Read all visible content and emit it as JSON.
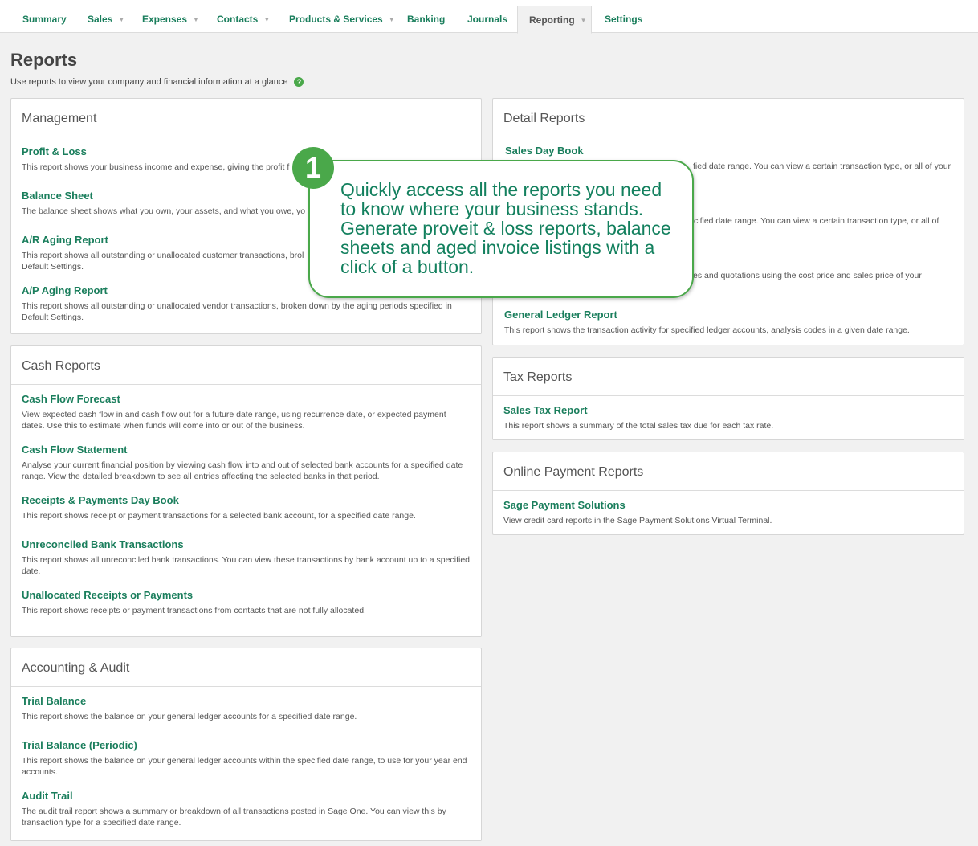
{
  "nav": {
    "tabs": [
      {
        "label": "Summary",
        "dropdown": false
      },
      {
        "label": "Sales",
        "dropdown": true
      },
      {
        "label": "Expenses",
        "dropdown": true
      },
      {
        "label": "Contacts",
        "dropdown": true
      },
      {
        "label": "Products & Services",
        "dropdown": true
      },
      {
        "label": "Banking",
        "dropdown": false
      },
      {
        "label": "Journals",
        "dropdown": false
      },
      {
        "label": "Reporting",
        "dropdown": true,
        "active": true
      },
      {
        "label": "Settings",
        "dropdown": false
      }
    ],
    "caret": "▼"
  },
  "header": {
    "title": "Reports",
    "subtitle": "Use reports to view your company and financial information at a glance",
    "help_icon": "?"
  },
  "panels": {
    "management": {
      "title": "Management",
      "items": [
        {
          "title": "Profit & Loss",
          "desc": "This report shows your business income and expense, giving the profit f"
        },
        {
          "title": "Balance Sheet",
          "desc": "The balance sheet shows what you own, your assets, and what you owe, yo"
        },
        {
          "title": "A/R Aging Report",
          "desc": "This report shows all outstanding or unallocated customer transactions, brol\nDefault Settings."
        },
        {
          "title": "A/P Aging Report",
          "desc": "This report shows all outstanding or unallocated vendor transactions, broken down by the aging periods specified in Default Settings."
        }
      ]
    },
    "cash": {
      "title": "Cash Reports",
      "items": [
        {
          "title": "Cash Flow Forecast",
          "desc": "View expected cash flow in and cash flow out for a future date range, using recurrence date, or expected payment dates. Use this to estimate when funds will come into or out of the business."
        },
        {
          "title": "Cash Flow Statement",
          "desc": "Analyse your current financial position by viewing cash flow into and out of selected bank accounts for a specified date range. View the detailed breakdown to see all entries affecting the selected banks in that period."
        },
        {
          "title": "Receipts & Payments Day Book",
          "desc": "This report shows receipt or payment transactions for a selected bank account, for a specified date range."
        },
        {
          "title": "Unreconciled Bank Transactions",
          "desc": "This report shows all unreconciled bank transactions. You can view these transactions by bank account up to a specified date."
        },
        {
          "title": "Unallocated Receipts or Payments",
          "desc": "This report shows receipts or payment transactions from contacts that are not fully allocated."
        }
      ]
    },
    "accounting": {
      "title": "Accounting & Audit",
      "items": [
        {
          "title": "Trial Balance",
          "desc": "This report shows the balance on your general ledger accounts for a specified date range."
        },
        {
          "title": "Trial Balance (Periodic)",
          "desc": "This report shows the balance on your general ledger accounts within the specified date range, to use for your year end accounts."
        },
        {
          "title": "Audit Trail",
          "desc": "The audit trail report shows a summary or breakdown of all transactions posted in Sage One. You can view this by transaction type for a specified date range."
        }
      ]
    },
    "detail": {
      "title": "Detail Reports",
      "sales_day_book": {
        "title": "Sales Day Book",
        "desc_fragment": "fied date range. You can view a certain transaction type, or all of your"
      },
      "hidden_item_2": {
        "desc_fragment": "cified date range. You can view a certain transaction type, or all of"
      },
      "hidden_item_3": {
        "desc_fragment": "es and quotations using the cost price and sales price of your"
      },
      "general_ledger": {
        "title": "General Ledger Report",
        "desc": "This report shows the transaction activity for specified ledger accounts, analysis codes in a given date range."
      }
    },
    "tax": {
      "title": "Tax Reports",
      "items": [
        {
          "title": "Sales Tax Report",
          "desc": "This report shows a summary of the total sales tax due for each tax rate."
        }
      ]
    },
    "online": {
      "title": "Online Payment Reports",
      "items": [
        {
          "title": "Sage Payment Solutions",
          "desc": "View credit card reports in the Sage Payment Solutions Virtual Terminal."
        }
      ]
    }
  },
  "callout": {
    "badge": "1",
    "text_lines": [
      "Quickly access all the reports you need",
      "to know where your business stands.",
      "Generate proveit & loss reports, balance",
      "sheets and aged invoice listings with a",
      "click of a button."
    ]
  },
  "colors": {
    "brand_green": "#1a7e5c",
    "callout_green": "#4aa84a",
    "page_bg": "#f1f1f1"
  }
}
